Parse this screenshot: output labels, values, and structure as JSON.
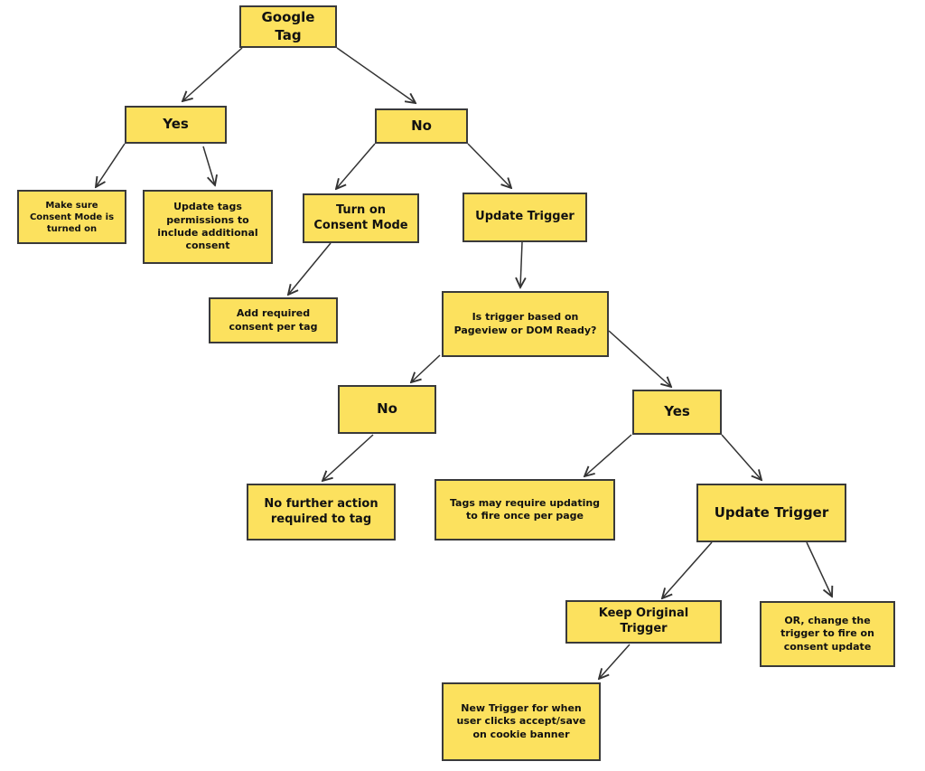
{
  "diagram": {
    "type": "flowchart",
    "colors": {
      "node_fill": "#fce15e",
      "node_border": "#3a3a3a",
      "edge": "#333333",
      "text": "#111111",
      "background": "#ffffff"
    },
    "nodes": [
      {
        "id": "google-tag",
        "label": "Google Tag"
      },
      {
        "id": "yes-1",
        "label": "Yes"
      },
      {
        "id": "no-1",
        "label": "No"
      },
      {
        "id": "consent-mode-on",
        "label": "Make sure Consent Mode is turned on"
      },
      {
        "id": "update-permissions",
        "label": "Update tags permissions to include additional consent"
      },
      {
        "id": "turn-on-consent",
        "label": "Turn on Consent Mode"
      },
      {
        "id": "update-trigger-1",
        "label": "Update Trigger"
      },
      {
        "id": "add-required-consent",
        "label": "Add required consent per tag"
      },
      {
        "id": "trigger-question",
        "label": "Is trigger based on Pageview or DOM Ready?"
      },
      {
        "id": "no-2",
        "label": "No"
      },
      {
        "id": "yes-2",
        "label": "Yes"
      },
      {
        "id": "no-further-action",
        "label": "No further action required to tag"
      },
      {
        "id": "tags-may-require",
        "label": "Tags may require updating to fire once per page"
      },
      {
        "id": "update-trigger-2",
        "label": "Update Trigger"
      },
      {
        "id": "keep-original",
        "label": "Keep Original Trigger"
      },
      {
        "id": "or-change-trigger",
        "label": "OR, change the trigger to fire on consent update"
      },
      {
        "id": "new-trigger",
        "label": "New Trigger for when user clicks accept/save on cookie banner"
      }
    ],
    "edges": [
      {
        "from": "google-tag",
        "to": "yes-1"
      },
      {
        "from": "google-tag",
        "to": "no-1"
      },
      {
        "from": "yes-1",
        "to": "consent-mode-on"
      },
      {
        "from": "yes-1",
        "to": "update-permissions"
      },
      {
        "from": "no-1",
        "to": "turn-on-consent"
      },
      {
        "from": "no-1",
        "to": "update-trigger-1"
      },
      {
        "from": "turn-on-consent",
        "to": "add-required-consent"
      },
      {
        "from": "update-trigger-1",
        "to": "trigger-question"
      },
      {
        "from": "trigger-question",
        "to": "no-2"
      },
      {
        "from": "trigger-question",
        "to": "yes-2"
      },
      {
        "from": "no-2",
        "to": "no-further-action"
      },
      {
        "from": "yes-2",
        "to": "tags-may-require"
      },
      {
        "from": "yes-2",
        "to": "update-trigger-2"
      },
      {
        "from": "update-trigger-2",
        "to": "keep-original"
      },
      {
        "from": "update-trigger-2",
        "to": "or-change-trigger"
      },
      {
        "from": "keep-original",
        "to": "new-trigger"
      }
    ]
  }
}
